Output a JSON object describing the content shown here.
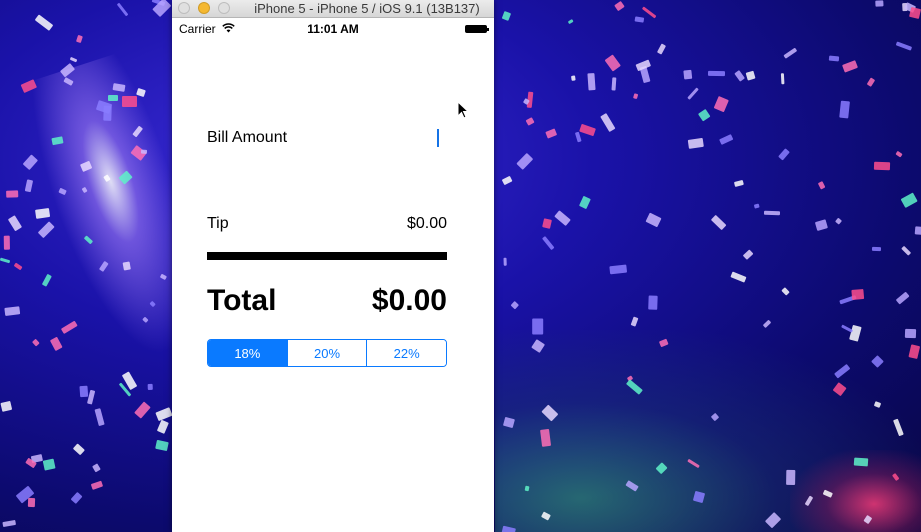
{
  "window": {
    "title": "iPhone 5 - iPhone 5 / iOS 9.1 (13B137)"
  },
  "statusbar": {
    "carrier": "Carrier",
    "time": "11:01 AM",
    "wifi_icon": "wifi-icon",
    "battery_icon": "battery-icon"
  },
  "bill": {
    "label": "Bill Amount",
    "value": "",
    "placeholder": ""
  },
  "tip": {
    "label": "Tip",
    "value": "$0.00"
  },
  "total": {
    "label": "Total",
    "value": "$0.00"
  },
  "tip_percentages": {
    "options": [
      "18%",
      "20%",
      "22%"
    ],
    "selected": "18%"
  },
  "colors": {
    "accent": "#0a7aff",
    "caret": "#1573e6",
    "divider": "#000000",
    "minimize_button": "#f5b830"
  }
}
